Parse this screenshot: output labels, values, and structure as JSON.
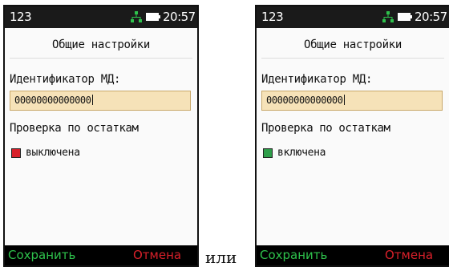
{
  "separator": "или",
  "colors": {
    "statusbar_bg": "#1a1a1a",
    "input_bg": "#f6e2b8",
    "save_key": "#2ec24c",
    "cancel_key": "#d8202a",
    "off_square": "#d8202a",
    "on_square": "#2e9e4a"
  },
  "screens": [
    {
      "status": {
        "left_text": "123",
        "network_icon": "network-icon",
        "battery_icon": "battery-icon",
        "time": "20:57"
      },
      "title": "Общие настройки",
      "id_field": {
        "label": "Идентификатор МД:",
        "value": "00000000000000"
      },
      "check_label": "Проверка по остаткам",
      "toggle": {
        "state": "off",
        "text": "выключена",
        "color": "#d8202a"
      },
      "softkeys": {
        "save": "Сохранить",
        "cancel": "Отмена"
      }
    },
    {
      "status": {
        "left_text": "123",
        "network_icon": "network-icon",
        "battery_icon": "battery-icon",
        "time": "20:57"
      },
      "title": "Общие настройки",
      "id_field": {
        "label": "Идентификатор МД:",
        "value": "00000000000000"
      },
      "check_label": "Проверка по остаткам",
      "toggle": {
        "state": "on",
        "text": "включена",
        "color": "#2e9e4a"
      },
      "softkeys": {
        "save": "Сохранить",
        "cancel": "Отмена"
      }
    }
  ]
}
